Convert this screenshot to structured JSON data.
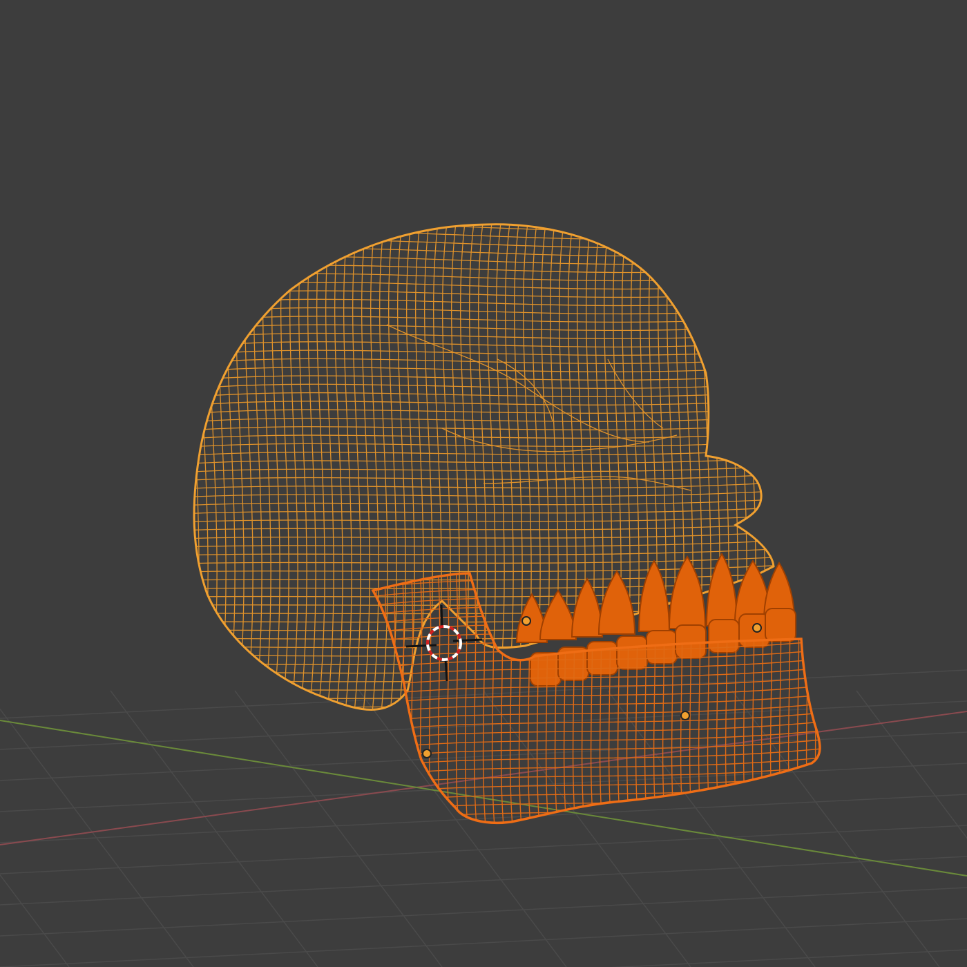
{
  "viewport": {
    "background": "#3d3d3d",
    "grid_color": "#4a4a4a",
    "x_axis_color": "#8a4a4f",
    "y_axis_color": "#6a8a3a"
  },
  "objects": [
    {
      "name": "skull",
      "display": "wireframe",
      "state": "selected",
      "color": "#f0a030"
    },
    {
      "name": "teeth",
      "display": "solid",
      "state": "active-selected",
      "color": "#e56a0a"
    },
    {
      "name": "jaw",
      "display": "wireframe",
      "state": "active-selected",
      "color": "#ef6d15"
    }
  ],
  "origin_dot_color": "#f0a030",
  "cursor": {
    "name": "3d-cursor-icon",
    "ring_primary": "#ffffff",
    "ring_secondary": "#d22020",
    "crosshair": "#111111"
  }
}
